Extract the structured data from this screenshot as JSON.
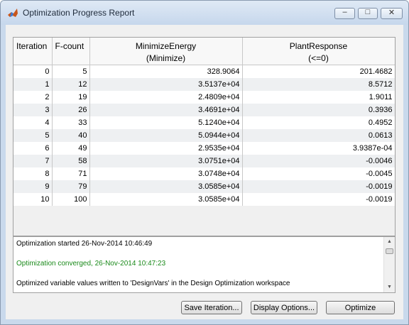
{
  "window": {
    "title": "Optimization Progress Report",
    "controls": {
      "minimize": "–",
      "maximize": "□",
      "close": "✕"
    },
    "app_icon": "matlab-icon"
  },
  "table": {
    "headers": [
      {
        "line1": "Iteration",
        "line2": ""
      },
      {
        "line1": "F-count",
        "line2": ""
      },
      {
        "line1": "MinimizeEnergy",
        "line2": "(Minimize)"
      },
      {
        "line1": "PlantResponse",
        "line2": "(<=0)"
      }
    ],
    "rows": [
      [
        "0",
        "5",
        "328.9064",
        "201.4682"
      ],
      [
        "1",
        "12",
        "3.5137e+04",
        "8.5712"
      ],
      [
        "2",
        "19",
        "2.4809e+04",
        "1.9011"
      ],
      [
        "3",
        "26",
        "3.4691e+04",
        "0.3936"
      ],
      [
        "4",
        "33",
        "5.1240e+04",
        "0.4952"
      ],
      [
        "5",
        "40",
        "5.0944e+04",
        "0.0613"
      ],
      [
        "6",
        "49",
        "2.9535e+04",
        "3.9387e-04"
      ],
      [
        "7",
        "58",
        "3.0751e+04",
        "-0.0046"
      ],
      [
        "8",
        "71",
        "3.0748e+04",
        "-0.0045"
      ],
      [
        "9",
        "79",
        "3.0585e+04",
        "-0.0019"
      ],
      [
        "10",
        "100",
        "3.0585e+04",
        "-0.0019"
      ]
    ]
  },
  "log": {
    "lines": [
      "Optimization started 26-Nov-2014 10:46:49",
      "Optimization converged, 26-Nov-2014 10:47:23",
      "Optimized variable values written to 'DesignVars' in the Design Optimization workspace"
    ]
  },
  "buttons": {
    "save_iteration": "Save Iteration...",
    "display_options": "Display Options...",
    "optimize": "Optimize"
  },
  "colors": {
    "success_text": "#1a8a1a"
  }
}
